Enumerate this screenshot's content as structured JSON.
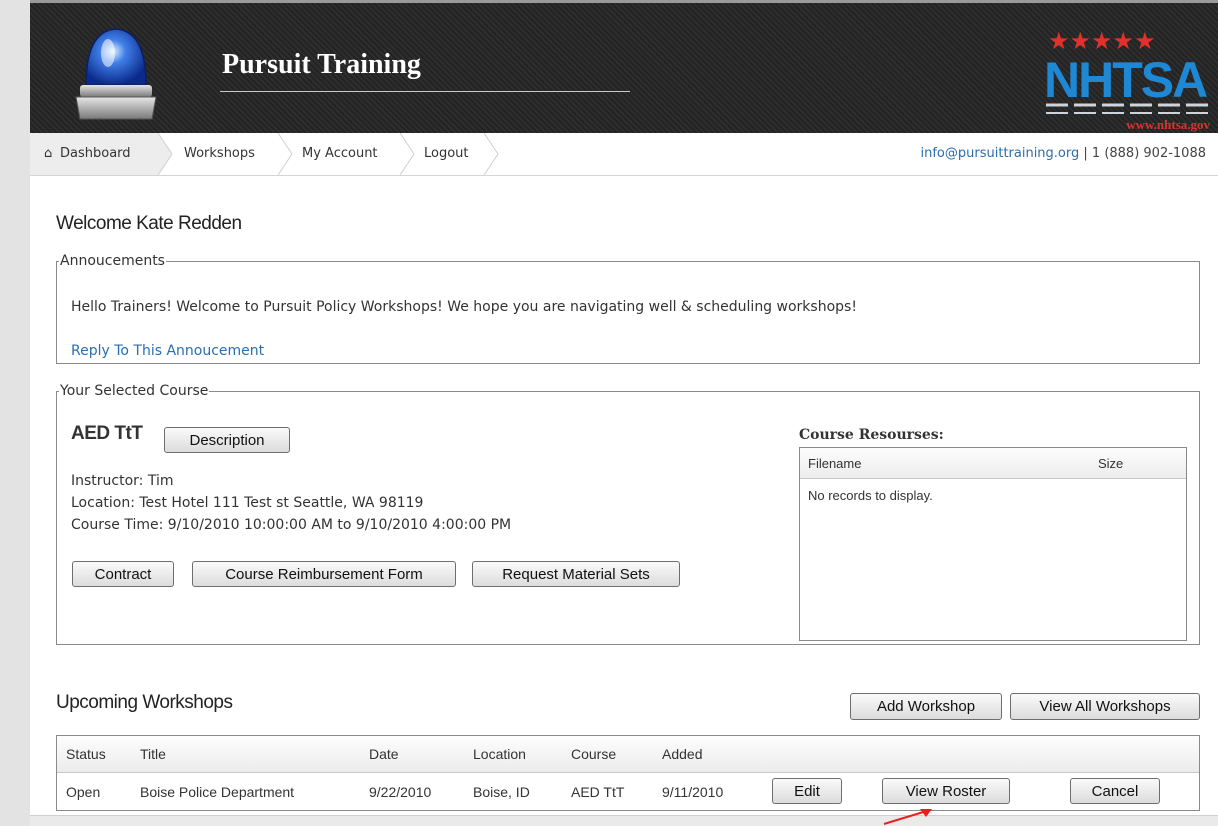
{
  "header": {
    "site_title": "Pursuit Training",
    "logo_text": "NHTSA",
    "logo_url_text": "www.nhtsa.gov",
    "logo_stars": "★★★★★"
  },
  "nav": {
    "items": [
      {
        "label": "Dashboard",
        "icon": "home-icon"
      },
      {
        "label": "Workshops"
      },
      {
        "label": "My Account"
      },
      {
        "label": "Logout"
      }
    ],
    "contact_email": "info@pursuittraining.org",
    "contact_phone": "| 1 (888) 902-1088"
  },
  "welcome": "Welcome Kate Redden",
  "announcements": {
    "legend": "Annoucements",
    "text": "Hello Trainers! Welcome to Pursuit Policy Workshops! We hope you are navigating well & scheduling workshops!",
    "reply_link": "Reply To This Annoucement"
  },
  "course": {
    "legend": "Your Selected Course",
    "code": "AED TtT",
    "description_button": "Description",
    "instructor": "Instructor: Tim",
    "location": "Location: Test Hotel 111 Test st Seattle, WA 98119",
    "time": "Course Time: 9/10/2010 10:00:00 AM to 9/10/2010 4:00:00 PM",
    "buttons": {
      "contract": "Contract",
      "reimbursement": "Course Reimbursement Form",
      "materials": "Request Material Sets"
    },
    "resources": {
      "title": "Course Resourses:",
      "col_filename": "Filename",
      "col_size": "Size",
      "empty": "No records to display."
    }
  },
  "upcoming": {
    "title": "Upcoming Workshops",
    "add_button": "Add Workshop",
    "view_all_button": "View All Workshops",
    "columns": [
      "Status",
      "Title",
      "Date",
      "Location",
      "Course",
      "Added"
    ],
    "rows": [
      {
        "status": "Open",
        "title": "Boise Police Department",
        "date": "9/22/2010",
        "location": "Boise, ID",
        "course": "AED TtT",
        "added": "9/11/2010",
        "edit": "Edit",
        "view_roster": "View Roster",
        "cancel": "Cancel"
      }
    ]
  },
  "colors": {
    "link": "#2a6eae",
    "header_bg": "#2a2a2a",
    "nhtsa_blue": "#1e88d4",
    "nhtsa_red": "#e0312c"
  }
}
